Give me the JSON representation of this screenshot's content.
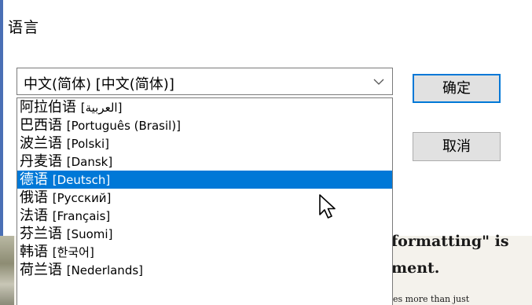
{
  "dialog": {
    "title": "语言",
    "combo_value": "中文(简体) [中文(简体)]",
    "ok_label": "确定",
    "cancel_label": "取消"
  },
  "languages": [
    {
      "name": "阿拉伯语",
      "native": "[العربية]"
    },
    {
      "name": "巴西语",
      "native": "[Português (Brasil)]"
    },
    {
      "name": "波兰语",
      "native": "[Polski]"
    },
    {
      "name": "丹麦语",
      "native": "[Dansk]"
    },
    {
      "name": "德语",
      "native": "[Deutsch]"
    },
    {
      "name": "俄语",
      "native": "[Русский]"
    },
    {
      "name": "法语",
      "native": "[Français]"
    },
    {
      "name": "芬兰语",
      "native": "[Suomi]"
    },
    {
      "name": "韩语",
      "native": "[한국어]"
    },
    {
      "name": "荷兰语",
      "native": "[Nederlands]"
    }
  ],
  "selected_index": 4,
  "background_document": {
    "line1": "formatting\" is",
    "line2": "ment.",
    "line3": "es more than just"
  },
  "colors": {
    "selection": "#0078d7",
    "default_button_border": "#0078d7"
  },
  "icons": {
    "combo_arrow": "chevron-down-icon",
    "cursor": "mouse-cursor-icon"
  }
}
